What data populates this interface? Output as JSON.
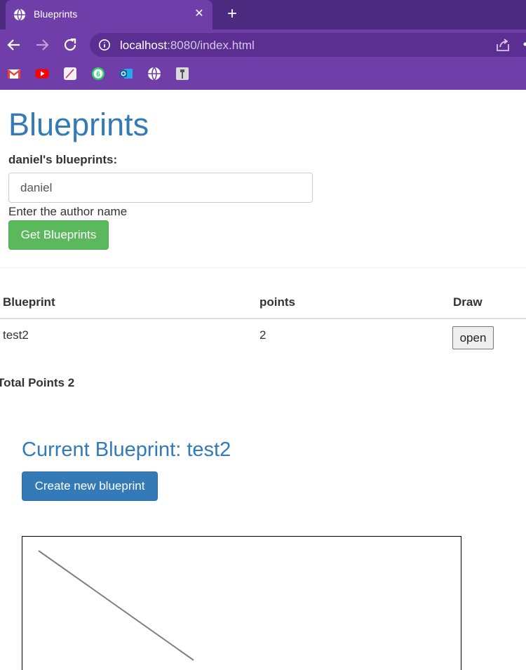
{
  "browser": {
    "tab_title": "Blueprints",
    "url_host": "localhost",
    "url_rest": ":8080/index.html",
    "bookmarks": [
      "gmail-icon",
      "youtube-icon",
      "pdf-icon",
      "whatsapp-icon",
      "outlook-icon",
      "globe-icon",
      "bookmark-app-icon"
    ]
  },
  "page": {
    "title": "Blueprints",
    "subtitle": "daniel's blueprints:",
    "author_input_value": "daniel",
    "author_help": "Enter the author name",
    "get_button": "Get Blueprints"
  },
  "table": {
    "headers": [
      "Blueprint",
      "points",
      "Draw"
    ],
    "rows": [
      {
        "name": "test2",
        "points": "2",
        "action": "open"
      }
    ],
    "total_label": "Total Points 2"
  },
  "current": {
    "title": "Current Blueprint: test2",
    "create_button": "Create new blueprint"
  },
  "colors": {
    "chrome_dark": "#4c2a7f",
    "chrome": "#6f3ea8",
    "link_blue": "#337ab7",
    "success": "#5cb85c"
  }
}
